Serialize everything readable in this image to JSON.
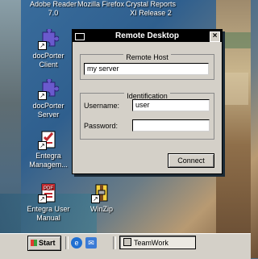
{
  "desktop_top_labels": [
    {
      "line1": "Adobe Reader",
      "line2": "7.0"
    },
    {
      "line1": "Mozilla Firefox",
      "line2": ""
    },
    {
      "line1": "Crystal Reports",
      "line2": "XI Release 2"
    }
  ],
  "desktop_icons": [
    {
      "line1": "docPorter",
      "line2": "Client",
      "icon": "puzzle-icon"
    },
    {
      "line1": "docPorter",
      "line2": "Server",
      "icon": "puzzle-icon"
    },
    {
      "line1": "Entegra",
      "line2": "Managem...",
      "icon": "checklist-icon"
    },
    {
      "line1": "Entegra User",
      "line2": "Manual",
      "icon": "pdf-icon"
    },
    {
      "line1": "WinZip",
      "line2": "",
      "icon": "winzip-icon"
    }
  ],
  "dialog": {
    "title": "Remote Desktop",
    "remote_host_legend": "Remote Host",
    "host_value": "my server",
    "identification_legend": "Identification",
    "username_label": "Username:",
    "username_value": "user",
    "password_label": "Password:",
    "password_value": "",
    "connect_label": "Connect"
  },
  "taskbar": {
    "start_label": "Start",
    "task_label": "TeamWork"
  },
  "colors": {
    "titlebar": "#000000",
    "dialog_bg": "#d4d0c8",
    "ie_blue": "#1f6fd1"
  }
}
